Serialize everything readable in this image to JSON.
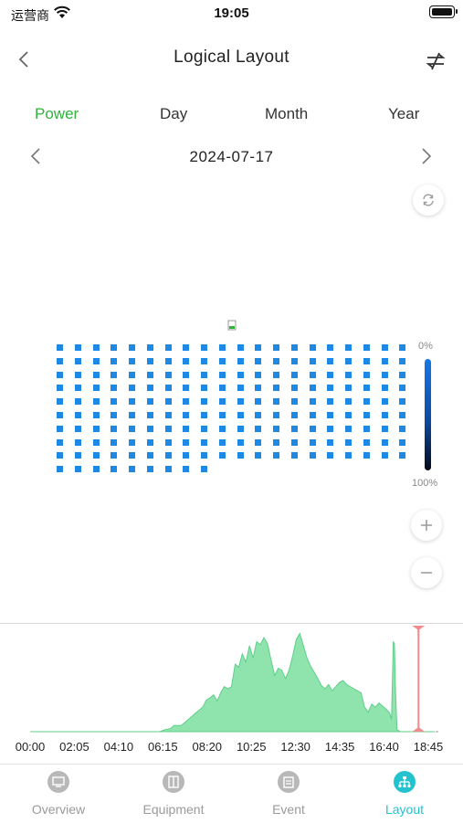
{
  "status_bar": {
    "carrier": "运营商",
    "time": "19:05"
  },
  "header": {
    "title": "Logical Layout"
  },
  "tabs": [
    {
      "label": "Power",
      "active": true
    },
    {
      "label": "Day",
      "active": false
    },
    {
      "label": "Month",
      "active": false
    },
    {
      "label": "Year",
      "active": false
    }
  ],
  "date_nav": {
    "date": "2024-07-17"
  },
  "layout_grid": {
    "rows": 10,
    "columns": 20,
    "last_row_count": 9,
    "module_color": "#1e88e5"
  },
  "legend": {
    "top_label": "0%",
    "bottom_label": "100%"
  },
  "chart_data": {
    "type": "area",
    "x_tick_labels": [
      "00:00",
      "02:05",
      "04:10",
      "06:15",
      "08:20",
      "10:25",
      "12:30",
      "14:35",
      "16:40",
      "18:45"
    ],
    "x_minutes": [
      0,
      360,
      375,
      390,
      400,
      420,
      440,
      460,
      480,
      490,
      500,
      510,
      520,
      530,
      540,
      550,
      560,
      570,
      580,
      590,
      600,
      610,
      620,
      630,
      640,
      650,
      660,
      670,
      680,
      690,
      700,
      710,
      720,
      730,
      740,
      750,
      760,
      770,
      780,
      790,
      800,
      810,
      820,
      830,
      840,
      850,
      860,
      870,
      880,
      890,
      900,
      910,
      920,
      930,
      940,
      950,
      960,
      970,
      980,
      990,
      1000,
      1005,
      1010,
      1013,
      1016,
      1020,
      1030,
      1050,
      1125
    ],
    "series": [
      {
        "values": [
          0,
          0,
          2,
          3,
          6,
          6,
          12,
          18,
          24,
          31,
          33,
          36,
          30,
          38,
          44,
          42,
          44,
          66,
          63,
          76,
          68,
          84,
          72,
          88,
          85,
          92,
          86,
          70,
          55,
          62,
          60,
          52,
          60,
          74,
          90,
          96,
          84,
          72,
          64,
          58,
          52,
          45,
          42,
          46,
          40,
          44,
          48,
          50,
          46,
          44,
          42,
          40,
          38,
          24,
          19,
          27,
          24,
          28,
          25,
          22,
          18,
          12,
          88,
          86,
          40,
          2,
          0,
          0,
          0
        ],
        "color": "#8fe3ad"
      }
    ],
    "marker_color": "#f28b8b",
    "marker_minutes": 1080
  },
  "tabbar": [
    {
      "label": "Overview",
      "active": false,
      "icon": "overview-icon"
    },
    {
      "label": "Equipment",
      "active": false,
      "icon": "equipment-icon"
    },
    {
      "label": "Event",
      "active": false,
      "icon": "event-icon"
    },
    {
      "label": "Layout",
      "active": true,
      "icon": "layout-icon"
    }
  ]
}
